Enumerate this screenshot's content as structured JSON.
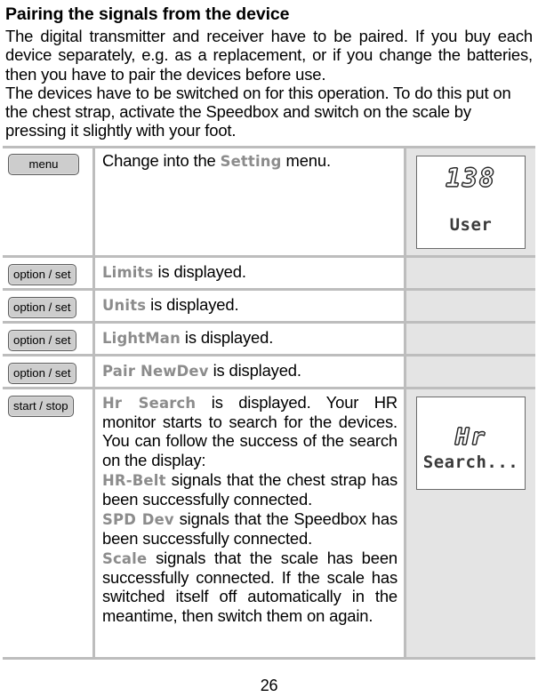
{
  "document": {
    "title": "Pairing the signals from the device",
    "paragraphs": [
      "The digital transmitter and receiver have to be paired. If you buy each device separately, e.g. as a replacement, or if you change the batteries, then you have to pair the devices before use.",
      "The devices have to be switched on for this operation. To do this put on the chest strap, activate the Speedbox and switch on the scale by pressing it slightly with your foot."
    ],
    "page_number": "26"
  },
  "colors": {
    "display_text": "#8c8c8c",
    "button_face": "#cdcdcd",
    "table_border": "#bdbdbd",
    "cell_shade": "#e4e4e4"
  },
  "rows": [
    {
      "button": "menu",
      "text_before": "Change into the ",
      "display_word": "Setting",
      "text_after": " menu.",
      "lcd": {
        "segment": "138",
        "matrix": "User"
      }
    },
    {
      "button": "option / set",
      "display_word": "Limits",
      "text_after": " is displayed.",
      "lcd": null
    },
    {
      "button": "option / set",
      "display_word": "Units",
      "text_after": " is displayed.",
      "lcd": null
    },
    {
      "button": "option / set",
      "display_word": "LightMan",
      "text_after": " is displayed.",
      "lcd": null
    },
    {
      "button": "option / set",
      "display_word": "Pair NewDev",
      "text_after": " is displayed.",
      "lcd": null
    },
    {
      "button": "start / stop",
      "lcd": {
        "segment": "Hr",
        "matrix": "Search..."
      },
      "paragraphs": [
        {
          "display_word": "Hr Search",
          "text_after": " is displayed. Your HR monitor starts to search for the devices. You can follow the success of the search on the display:"
        },
        {
          "display_word": "HR-Belt",
          "text_after": " signals that the chest strap has been successfully connected."
        },
        {
          "display_word": "SPD Dev",
          "text_after": " signals that the Speedbox has been successfully connected."
        },
        {
          "display_word": "Scale",
          "text_after": " signals that the scale has been successfully connected. If the scale has switched itself off automatically in the meantime, then switch them on again."
        }
      ]
    }
  ]
}
